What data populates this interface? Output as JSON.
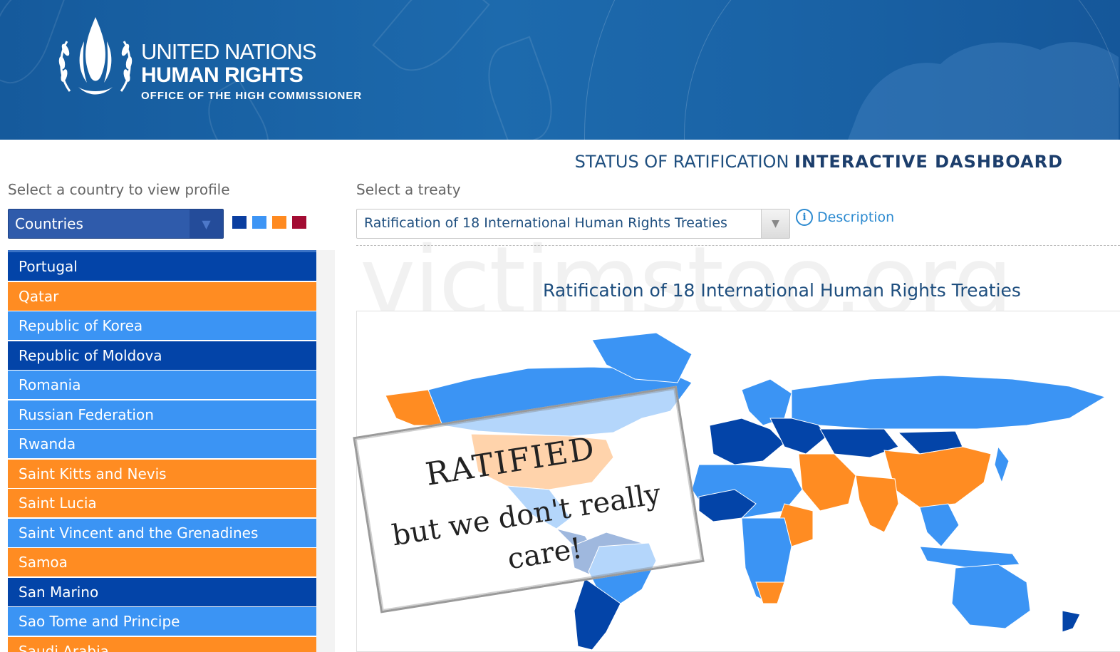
{
  "brand": {
    "line1": "UNITED NATIONS",
    "line2": "HUMAN RIGHTS",
    "line3": "OFFICE OF THE HIGH COMMISSIONER"
  },
  "dashboard": {
    "title_part1": "STATUS OF RATIFICATION ",
    "title_part2": "INTERACTIVE DASHBOARD"
  },
  "country_panel": {
    "label": "Select a country to view profile",
    "select_value": "Countries",
    "legend_colors": [
      "#0a3ea0",
      "#3d95f5",
      "#ff8a1f",
      "#a30c33"
    ],
    "countries": [
      {
        "name": "Portugal",
        "status_color": "#0344a8"
      },
      {
        "name": "Qatar",
        "status_color": "#ff8c22"
      },
      {
        "name": "Republic of Korea",
        "status_color": "#3b94f4"
      },
      {
        "name": "Republic of Moldova",
        "status_color": "#0344a8"
      },
      {
        "name": "Romania",
        "status_color": "#3b94f4"
      },
      {
        "name": "Russian Federation",
        "status_color": "#3b94f4"
      },
      {
        "name": "Rwanda",
        "status_color": "#3b94f4"
      },
      {
        "name": "Saint Kitts and Nevis",
        "status_color": "#ff8c22"
      },
      {
        "name": "Saint Lucia",
        "status_color": "#ff8c22"
      },
      {
        "name": "Saint Vincent and the Grenadines",
        "status_color": "#3b94f4"
      },
      {
        "name": "Samoa",
        "status_color": "#ff8c22"
      },
      {
        "name": "San Marino",
        "status_color": "#0344a8"
      },
      {
        "name": "Sao Tome and Principe",
        "status_color": "#3b94f4"
      },
      {
        "name": "Saudi Arabia",
        "status_color": "#ff8c22"
      }
    ]
  },
  "treaty_panel": {
    "label": "Select a treaty",
    "select_value": "Ratification of 18 International Human Rights Treaties",
    "description_link": "Description"
  },
  "chart": {
    "title": "Ratification of 18 International Human Rights Treaties"
  },
  "watermark": "victimstoo.org",
  "stamp": {
    "line1": "RATIFIED",
    "line2": "but we don't really",
    "line3": "care!"
  }
}
